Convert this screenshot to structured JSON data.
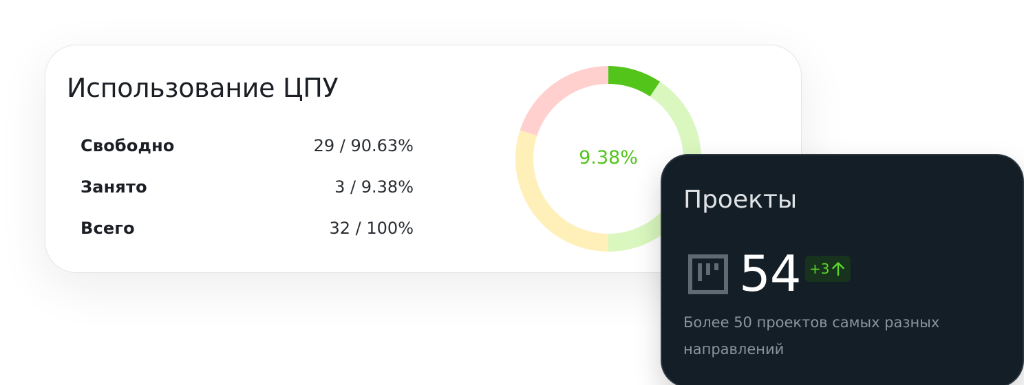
{
  "cpu": {
    "title": "Использование ЦПУ",
    "rows": [
      {
        "label": "Свободно",
        "value": "29 / 90.63%"
      },
      {
        "label": "Занято",
        "value": "3 / 9.38%"
      },
      {
        "label": "Всего",
        "value": "32 / 100%"
      }
    ],
    "donut": {
      "center_label": "9.38%",
      "used_fraction": 0.0938,
      "segments": [
        {
          "name": "used",
          "fraction": 0.0938,
          "color": "#52c41a"
        },
        {
          "name": "green-zone",
          "fraction": 0.4062,
          "color": "#d9f7be"
        },
        {
          "name": "yellow-zone",
          "fraction": 0.3,
          "color": "#ffefb8"
        },
        {
          "name": "red-zone",
          "fraction": 0.2,
          "color": "#ffd0ce"
        }
      ]
    }
  },
  "projects": {
    "title": "Проекты",
    "icon": "kanban-board-icon",
    "count": "54",
    "delta": "+3",
    "delta_icon": "arrow-up-icon",
    "description": "Более 50 проектов самых разных направлений"
  },
  "colors": {
    "accent_green": "#52c41a",
    "dark_card": "#131e26"
  }
}
